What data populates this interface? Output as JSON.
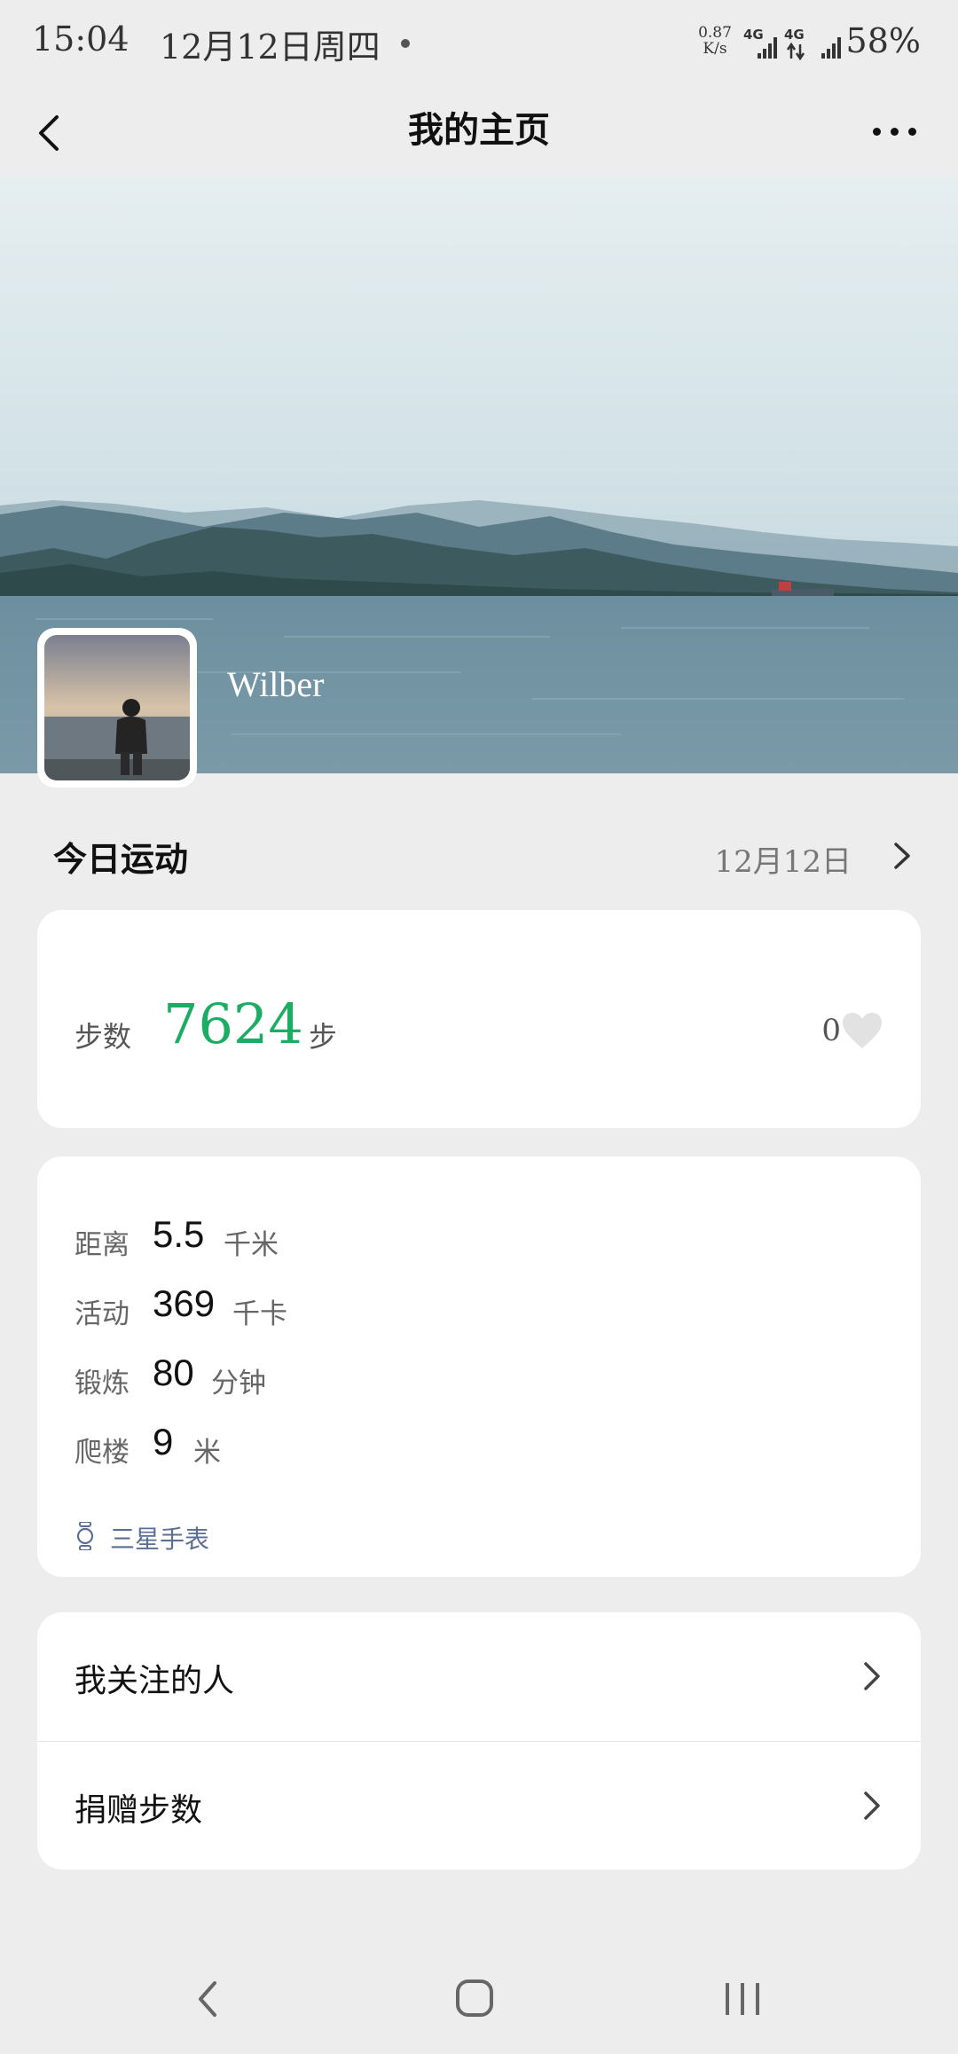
{
  "status_bar": {
    "time": "15:04",
    "date": "12月12日周四",
    "net_speed_value": "0.87",
    "net_speed_unit": "K/s",
    "network_type_1": "4G",
    "network_type_2": "4G",
    "battery": "58%"
  },
  "nav": {
    "title": "我的主页",
    "back_icon": "chevron-left-icon",
    "more_icon": "more-dots-icon"
  },
  "profile": {
    "username": "Wilber"
  },
  "today": {
    "title": "今日运动",
    "date": "12月12日"
  },
  "steps": {
    "label": "步数",
    "value": "7624",
    "unit": "步",
    "likes": "0",
    "accent_color": "#1aad63"
  },
  "stats": [
    {
      "label": "距离",
      "value": "5.5",
      "unit": "千米"
    },
    {
      "label": "活动",
      "value": "369",
      "unit": "千卡"
    },
    {
      "label": "锻炼",
      "value": "80",
      "unit": "分钟"
    },
    {
      "label": "爬楼",
      "value": "9",
      "unit": "米"
    }
  ],
  "device": {
    "label": "三星手表",
    "icon": "watch-icon"
  },
  "menu": {
    "following": "我关注的人",
    "donate_steps": "捐赠步数"
  },
  "system_nav": {
    "back_icon": "back-icon",
    "home_icon": "home-icon",
    "recents_icon": "recents-icon"
  }
}
